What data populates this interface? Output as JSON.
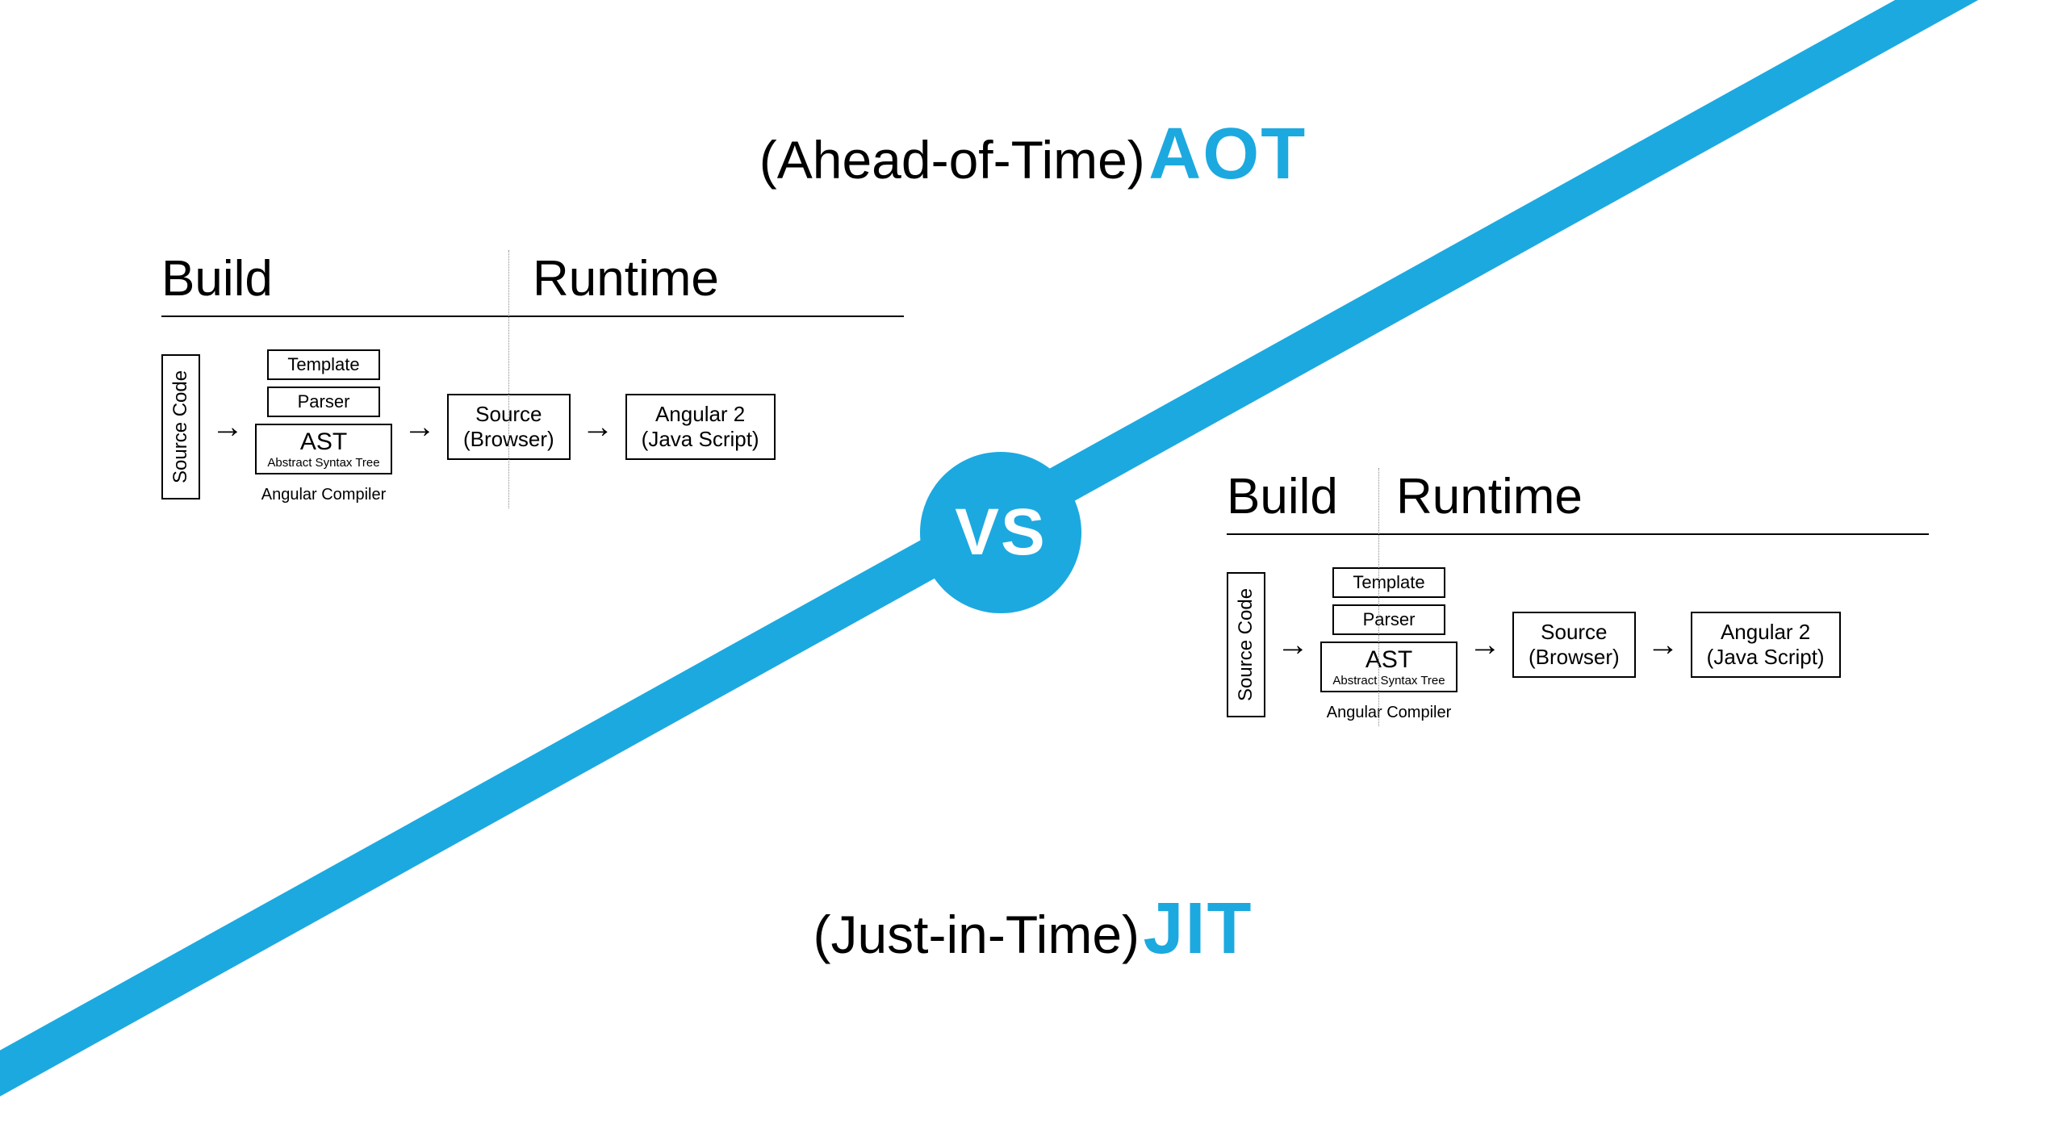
{
  "colors": {
    "accent": "#1ca9e0",
    "text": "#000000",
    "white": "#ffffff"
  },
  "top_title": {
    "paren": "(Ahead-of-Time)",
    "abbr": "AOT"
  },
  "bottom_title": {
    "paren": "(Just-in-Time)",
    "abbr": "JIT"
  },
  "vs": "VS",
  "aot": {
    "build_label": "Build",
    "runtime_label": "Runtime",
    "source_code": "Source Code",
    "template": "Template",
    "parser": "Parser",
    "ast": "AST",
    "ast_full": "Abstract Syntax Tree",
    "compiler_caption": "Angular Compiler",
    "source_browser_l1": "Source",
    "source_browser_l2": "(Browser)",
    "angular_l1": "Angular 2",
    "angular_l2": "(Java Script)"
  },
  "jit": {
    "build_label": "Build",
    "runtime_label": "Runtime",
    "source_code": "Source Code",
    "template": "Template",
    "parser": "Parser",
    "ast": "AST",
    "ast_full": "Abstract Syntax Tree",
    "compiler_caption": "Angular Compiler",
    "source_browser_l1": "Source",
    "source_browser_l2": "(Browser)",
    "angular_l1": "Angular 2",
    "angular_l2": "(Java Script)"
  }
}
